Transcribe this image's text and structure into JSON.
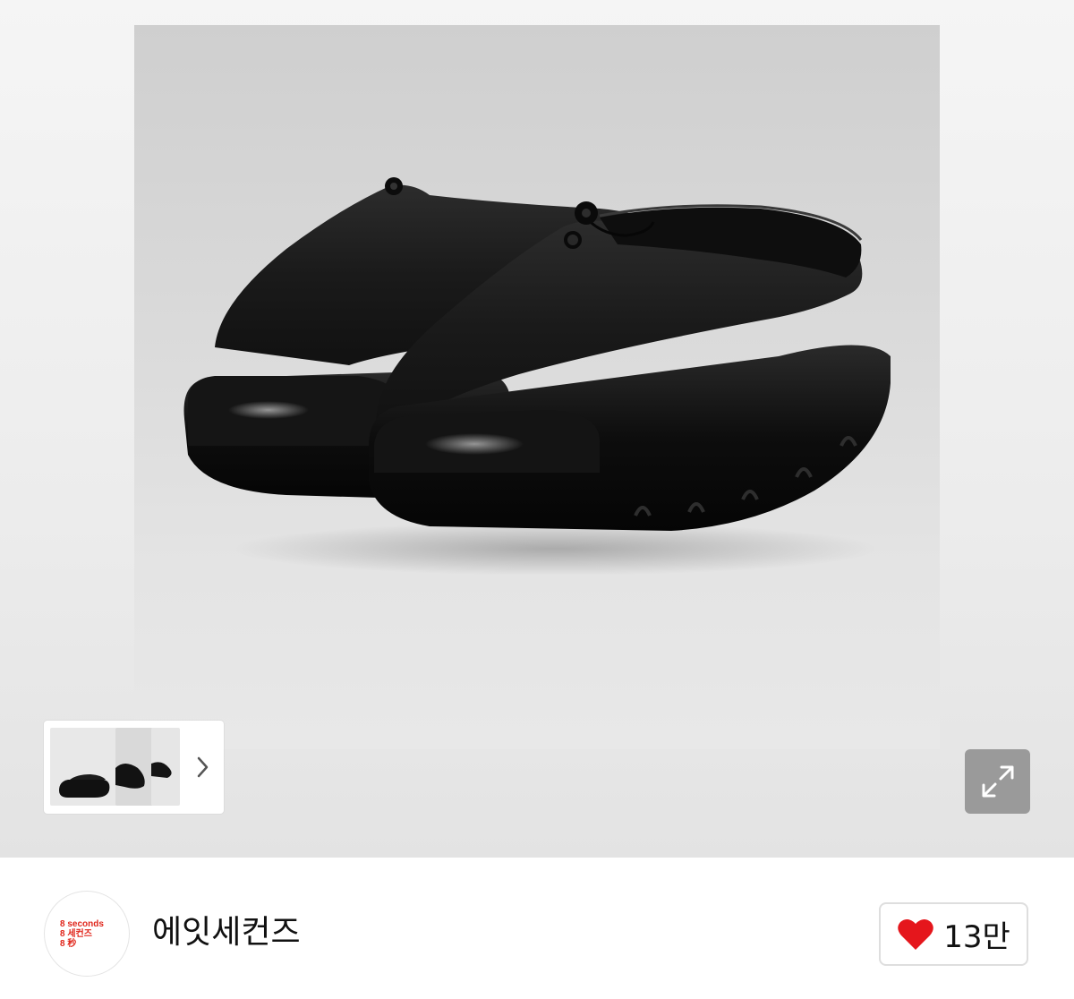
{
  "product": {
    "image_subject": "black-clog-shoes",
    "gallery": {
      "thumbnail_count": 3,
      "next_icon": "chevron-right-icon",
      "expand_icon": "expand-arrows-icon"
    }
  },
  "shop": {
    "name": "에잇세컨즈",
    "logo_lines": [
      "8 seconds",
      "8 세컨즈",
      "8 秒"
    ],
    "logo_color": "#e0261b"
  },
  "like": {
    "icon": "heart-icon",
    "count": "13만",
    "color": "#e5161c"
  }
}
